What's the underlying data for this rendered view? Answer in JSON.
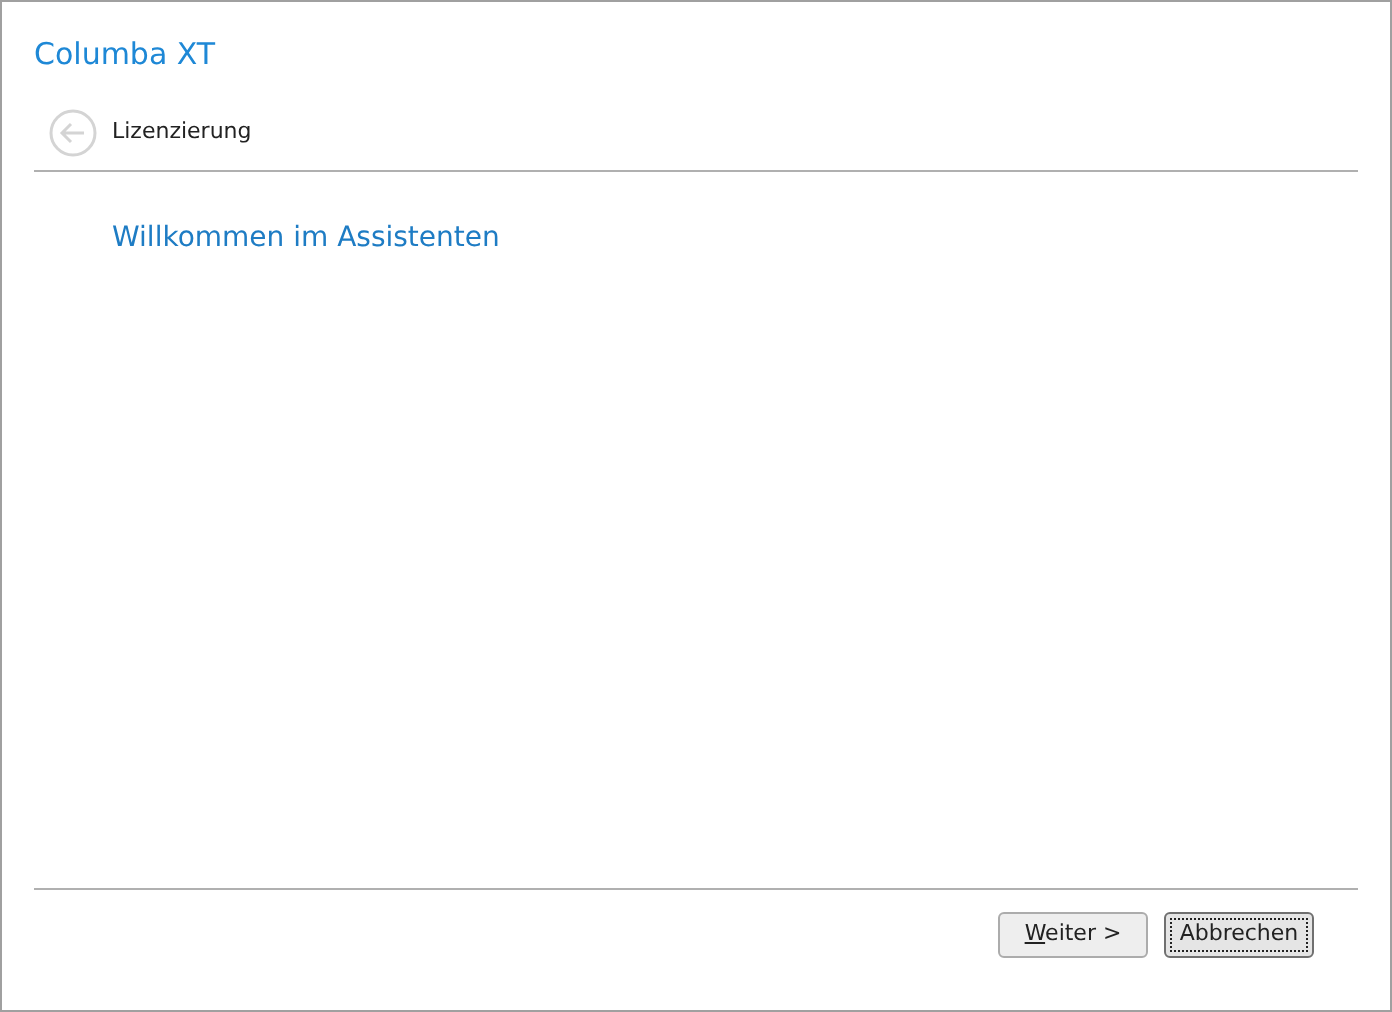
{
  "window": {
    "title": "Columba XT"
  },
  "nav": {
    "back_disabled": true,
    "label": "Lizenzierung"
  },
  "heading": "Willkommen im Assistenten",
  "buttons": [
    {
      "label": "Weiter >",
      "mnemonic": true,
      "focused": false
    },
    {
      "label": "Abbrechen",
      "mnemonic": false,
      "focused": true
    }
  ]
}
